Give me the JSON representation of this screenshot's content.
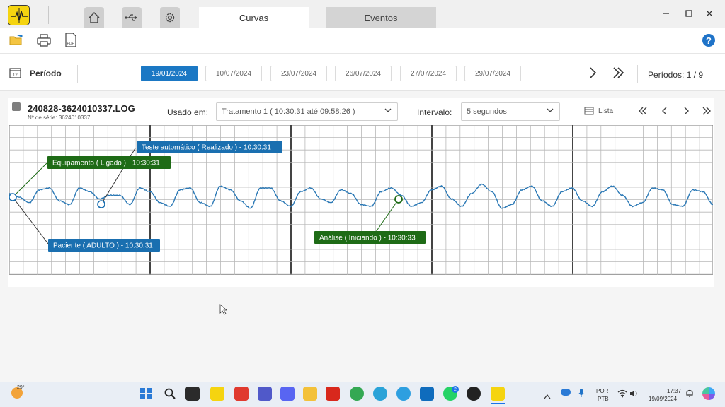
{
  "tabs": [
    {
      "label": "Curvas",
      "active": true
    },
    {
      "label": "Eventos",
      "active": false
    }
  ],
  "nav_icons": [
    "home-icon",
    "usb-icon",
    "gear-icon"
  ],
  "toolbar": {
    "icons": [
      "open-folder-icon",
      "print-icon",
      "pdf-icon"
    ],
    "pdf_label": "PDF",
    "help_label": "?"
  },
  "period": {
    "label": "Período",
    "dates": [
      "19/01/2024",
      "10/07/2024",
      "23/07/2024",
      "26/07/2024",
      "27/07/2024",
      "29/07/2024"
    ],
    "active_date": "19/01/2024",
    "count_label": "Períodos: 1 / 9"
  },
  "file": {
    "name": "240828-3624010337.LOG",
    "serial": "Nº de série: 3624010337"
  },
  "filters": {
    "usado_em_label": "Usado em:",
    "usado_em_value": "Tratamento 1 ( 10:30:31 até 09:58:26 )",
    "intervalo_label": "Intervalo:",
    "intervalo_value": "5 segundos",
    "list_label": "Lista"
  },
  "chart_data": {
    "type": "line",
    "series": [
      {
        "values": [
          0.2,
          0.0,
          -0.3,
          0.4,
          0.5,
          -0.2,
          -0.4,
          0.5,
          0.3,
          -0.1,
          0.1,
          0.1,
          -0.4,
          0.5,
          0.3,
          -0.3,
          -0.5,
          0.4,
          0.5,
          -0.3,
          -0.5,
          0.6,
          0.4,
          -0.2,
          -0.6,
          0.5,
          0.5,
          -0.2,
          -0.5,
          0.3,
          0.5,
          -0.1,
          -0.3,
          0.4,
          0.2,
          -0.4,
          -0.5,
          0.3,
          0.5,
          0.1,
          -0.5,
          -0.3,
          0.4,
          0.6,
          -0.1,
          -0.5,
          0.2,
          0.7,
          0.3,
          -0.6,
          -0.4,
          0.4,
          0.6,
          -0.2,
          -0.5,
          0.3,
          0.5,
          -0.2,
          -0.5,
          0.3,
          0.6,
          0.1,
          -0.5,
          -0.3,
          0.5,
          0.4,
          -0.4,
          -0.5,
          0.4,
          0.3,
          -0.4
        ]
      }
    ],
    "annotations": [
      {
        "label": "Teste automático ( Realizado ) - 10:30:31",
        "color": "#1a6fb0"
      },
      {
        "label": "Equipamento ( Ligado ) - 10:30:31",
        "color": "#1e6b16"
      },
      {
        "label": "Paciente ( ADULTO ) - 10:30:31",
        "color": "#1a6fb0"
      },
      {
        "label": "Análise ( Iniciando ) - 10:30:33",
        "color": "#1e6b16"
      }
    ],
    "line_color": "#2a78b5",
    "grid": true
  },
  "taskbar": {
    "weather_temp": "29°",
    "lang1": "POR",
    "lang2": "PTB",
    "time": "17:37",
    "date": "19/09/2024",
    "badge": "2"
  }
}
